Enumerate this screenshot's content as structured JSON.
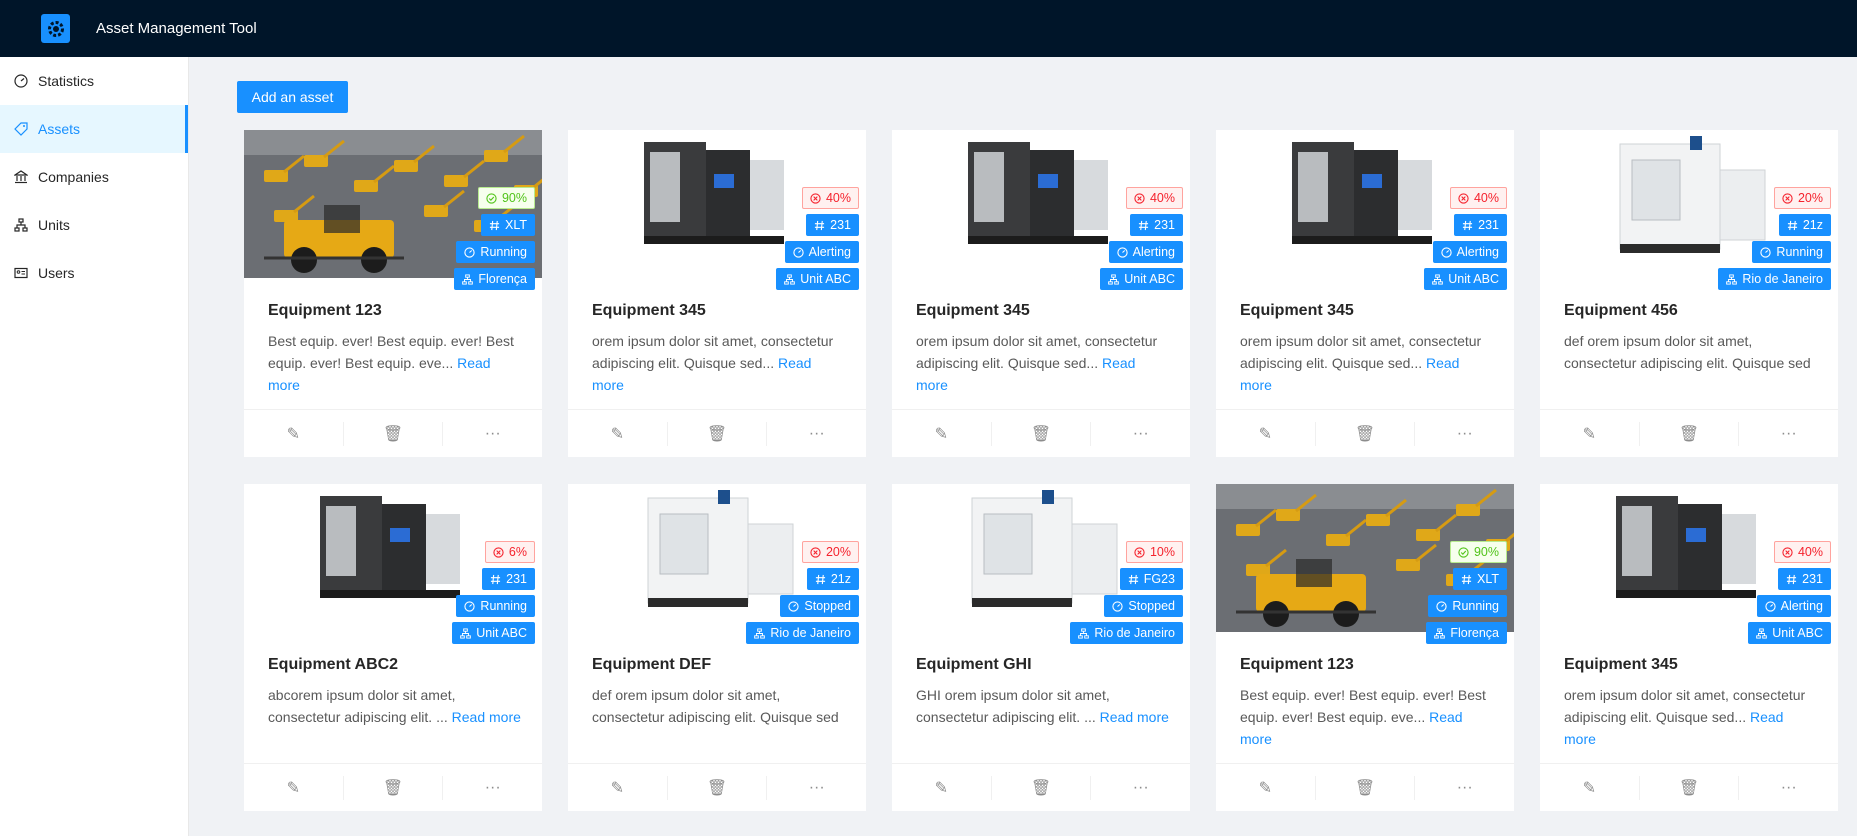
{
  "app": {
    "title": "Asset Management Tool"
  },
  "sidebar": {
    "items": [
      {
        "label": "Statistics",
        "icon": "dashboard-icon"
      },
      {
        "label": "Assets",
        "icon": "tag-icon",
        "active": true
      },
      {
        "label": "Companies",
        "icon": "bank-icon"
      },
      {
        "label": "Units",
        "icon": "cluster-icon"
      },
      {
        "label": "Users",
        "icon": "idcard-icon"
      }
    ]
  },
  "toolbar": {
    "add_label": "Add an asset"
  },
  "colors": {
    "header": "#001529",
    "primary": "#1890ff",
    "success": "#52c41a",
    "danger": "#f5222d"
  },
  "read_more_label": "Read more",
  "cards": [
    {
      "title": "Equipment 123",
      "image": "construction-site",
      "health": "90%",
      "health_status": "good",
      "model": "XLT",
      "status": "Running",
      "unit": "Florença",
      "desc": "Best equip. ever! Best equip. ever! Best equip. ever! Best equip. eve...",
      "read_more": true
    },
    {
      "title": "Equipment 345",
      "image": "cnc-machine-dark",
      "health": "40%",
      "health_status": "bad",
      "model": "231",
      "status": "Alerting",
      "unit": "Unit ABC",
      "desc": "orem ipsum dolor sit amet, consectetur adipiscing elit. Quisque sed...",
      "read_more": true
    },
    {
      "title": "Equipment 345",
      "image": "cnc-machine-dark",
      "health": "40%",
      "health_status": "bad",
      "model": "231",
      "status": "Alerting",
      "unit": "Unit ABC",
      "desc": "orem ipsum dolor sit amet, consectetur adipiscing elit. Quisque sed...",
      "read_more": true
    },
    {
      "title": "Equipment 345",
      "image": "cnc-machine-dark",
      "health": "40%",
      "health_status": "bad",
      "model": "231",
      "status": "Alerting",
      "unit": "Unit ABC",
      "desc": "orem ipsum dolor sit amet, consectetur adipiscing elit. Quisque sed...",
      "read_more": true
    },
    {
      "title": "Equipment 456",
      "image": "cnc-machine-white",
      "health": "20%",
      "health_status": "bad",
      "model": "21z",
      "status": "Running",
      "unit": "Rio de Janeiro",
      "desc": "def orem ipsum dolor sit amet, consectetur adipiscing elit. Quisque sed",
      "read_more": false
    },
    {
      "title": "Equipment ABC2",
      "image": "cnc-machine-dark",
      "health": "6%",
      "health_status": "bad",
      "model": "231",
      "status": "Running",
      "unit": "Unit ABC",
      "desc": "abcorem ipsum dolor sit amet, consectetur adipiscing elit. ...",
      "read_more": true
    },
    {
      "title": "Equipment DEF",
      "image": "cnc-machine-white",
      "health": "20%",
      "health_status": "bad",
      "model": "21z",
      "status": "Stopped",
      "unit": "Rio de Janeiro",
      "desc": "def orem ipsum dolor sit amet, consectetur adipiscing elit. Quisque sed",
      "read_more": false
    },
    {
      "title": "Equipment GHI",
      "image": "cnc-machine-white",
      "health": "10%",
      "health_status": "bad",
      "model": "FG23",
      "status": "Stopped",
      "unit": "Rio de Janeiro",
      "desc": "GHI orem ipsum dolor sit amet, consectetur adipiscing elit. ...",
      "read_more": true
    },
    {
      "title": "Equipment 123",
      "image": "construction-site",
      "health": "90%",
      "health_status": "good",
      "model": "XLT",
      "status": "Running",
      "unit": "Florença",
      "desc": "Best equip. ever! Best equip. ever! Best equip. ever! Best equip. eve...",
      "read_more": true
    },
    {
      "title": "Equipment 345",
      "image": "cnc-machine-dark",
      "health": "40%",
      "health_status": "bad",
      "model": "231",
      "status": "Alerting",
      "unit": "Unit ABC",
      "desc": "orem ipsum dolor sit amet, consectetur adipiscing elit. Quisque sed...",
      "read_more": true
    }
  ],
  "card_actions": [
    {
      "icon": "edit-icon",
      "glyph": "✎"
    },
    {
      "icon": "delete-icon",
      "glyph": "🗑"
    },
    {
      "icon": "more-icon",
      "glyph": "···"
    }
  ]
}
